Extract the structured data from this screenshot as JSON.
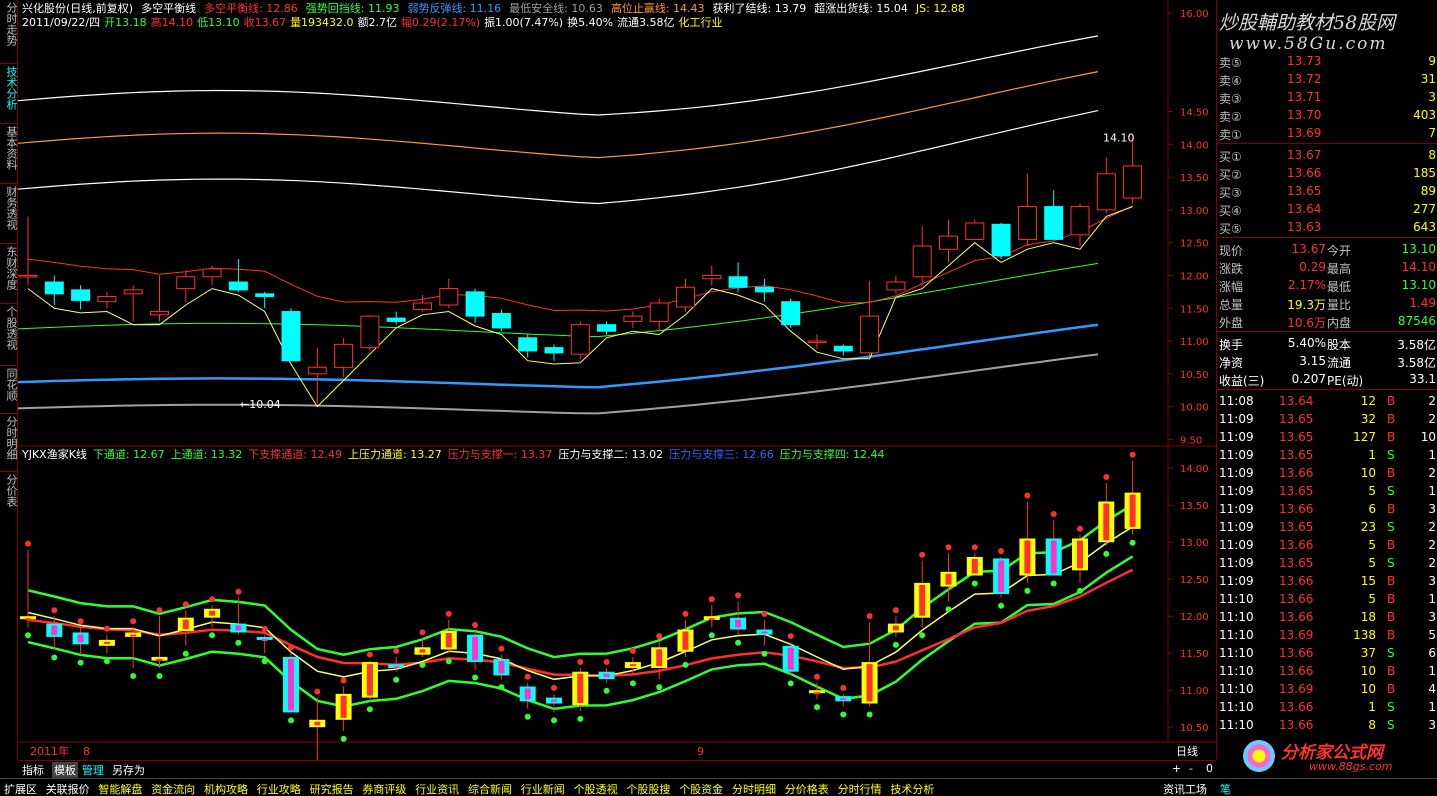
{
  "left_tabs": [
    {
      "label": "分时走势",
      "active": false
    },
    {
      "label": "技术分析",
      "active": true
    },
    {
      "label": "基本资料",
      "active": false
    },
    {
      "label": "财务透视",
      "active": false
    },
    {
      "label": "东财深度",
      "active": false
    },
    {
      "label": "个股透视",
      "active": false
    },
    {
      "label": "同花顺",
      "active": false
    },
    {
      "label": "分时明细",
      "active": false
    },
    {
      "label": "分价表",
      "active": false
    }
  ],
  "header1": [
    {
      "text": "兴化股份(日线,前复权)",
      "color": "#ffffff"
    },
    {
      "text": "多空平衡线",
      "color": "#ffffff"
    },
    {
      "text": "多空平衡线: 12.86",
      "color": "#ff3030"
    },
    {
      "text": "强势回挡线: 11.93",
      "color": "#30ff30"
    },
    {
      "text": "弱势反弹线: 11.16",
      "color": "#3399ff"
    },
    {
      "text": "最低安全线: 10.63",
      "color": "#a0a0a0"
    },
    {
      "text": "高位止赢线: 14.43",
      "color": "#ff9933"
    },
    {
      "text": "获利了结线: 13.79",
      "color": "#ffffff"
    },
    {
      "text": "超涨出货线: 15.04",
      "color": "#ffffff"
    },
    {
      "text": "JS: 12.88",
      "color": "#ffff00"
    }
  ],
  "header2": [
    {
      "text": "2011/09/22/四",
      "color": "#ffffff"
    },
    {
      "text": "开13.18",
      "color": "#30ff30"
    },
    {
      "text": "高14.10",
      "color": "#ff3030"
    },
    {
      "text": "低13.10",
      "color": "#30ff30"
    },
    {
      "text": "收13.67",
      "color": "#ff3030"
    },
    {
      "text": "量193432.0",
      "color": "#ffff00"
    },
    {
      "text": "额2.7亿",
      "color": "#ffffff"
    },
    {
      "text": "幅0.29(2.17%)",
      "color": "#ff3030"
    },
    {
      "text": "振1.00(7.47%)",
      "color": "#ffffff"
    },
    {
      "text": "换5.40%",
      "color": "#ffffff"
    },
    {
      "text": "流通3.58亿",
      "color": "#ffffff"
    },
    {
      "text": "化工行业",
      "color": "#ffff00"
    }
  ],
  "header3": [
    {
      "text": "YJKX渔家K线",
      "color": "#ffffff"
    },
    {
      "text": "下通道: 12.67",
      "color": "#30ff30"
    },
    {
      "text": "上通道: 13.32",
      "color": "#30ff30"
    },
    {
      "text": "下支撑通道: 12.49",
      "color": "#ff3030"
    },
    {
      "text": "上压力通道: 13.27",
      "color": "#ffff00"
    },
    {
      "text": "压力与支撑一: 13.37",
      "color": "#ff3030"
    },
    {
      "text": "压力与支撑二: 13.02",
      "color": "#ffffff"
    },
    {
      "text": "压力与支撑三: 12.66",
      "color": "#3366ff"
    },
    {
      "text": "压力与支撑四: 12.44",
      "color": "#30ff30"
    }
  ],
  "annotations": {
    "high": "14.10",
    "low": "←10.04"
  },
  "axis_top": [
    "16.00",
    "14.50",
    "14.00",
    "13.50",
    "13.00",
    "12.50",
    "12.00",
    "11.50",
    "11.00",
    "10.50",
    "10.00",
    "9.50"
  ],
  "axis_bottom": [
    "14.00",
    "13.50",
    "13.00",
    "12.50",
    "12.00",
    "11.50",
    "11.00",
    "10.50"
  ],
  "bottom_axis": {
    "year": "2011年",
    "m1": "8",
    "m2": "9"
  },
  "period": "日线",
  "zoom_controls": [
    "+",
    "-",
    "0"
  ],
  "watermark": {
    "line1": "炒股輔助教材58股网",
    "line2": "www.58Gu.com",
    "logo": "分析家公式网",
    "url": "www.88gs.com"
  },
  "orderbook": {
    "sell": [
      {
        "label": "卖⑤",
        "price": "13.73",
        "vol": "9"
      },
      {
        "label": "卖④",
        "price": "13.72",
        "vol": "31"
      },
      {
        "label": "卖③",
        "price": "13.71",
        "vol": "3"
      },
      {
        "label": "卖②",
        "price": "13.70",
        "vol": "403"
      },
      {
        "label": "卖①",
        "price": "13.69",
        "vol": "7"
      }
    ],
    "buy": [
      {
        "label": "买①",
        "price": "13.67",
        "vol": "8"
      },
      {
        "label": "买②",
        "price": "13.66",
        "vol": "185"
      },
      {
        "label": "买③",
        "price": "13.65",
        "vol": "89"
      },
      {
        "label": "买④",
        "price": "13.64",
        "vol": "277"
      },
      {
        "label": "买⑤",
        "price": "13.63",
        "vol": "643"
      }
    ]
  },
  "stats": [
    {
      "l1": "现价",
      "v1": "13.67",
      "c1": "#ff3030",
      "l2": "今开",
      "v2": "13.10",
      "c2": "#30ff30"
    },
    {
      "l1": "涨跌",
      "v1": "0.29",
      "c1": "#ff3030",
      "l2": "最高",
      "v2": "14.10",
      "c2": "#ff3030"
    },
    {
      "l1": "涨幅",
      "v1": "2.17%",
      "c1": "#ff3030",
      "l2": "最低",
      "v2": "13.10",
      "c2": "#30ff30"
    },
    {
      "l1": "总量",
      "v1": "19.3万",
      "c1": "#ffff00",
      "l2": "量比",
      "v2": "1.49",
      "c2": "#ff3030"
    },
    {
      "l1": "外盘",
      "v1": "10.6万",
      "c1": "#ff3030",
      "l2": "内盘",
      "v2": "87546",
      "c2": "#30ff30"
    }
  ],
  "fundamentals": [
    {
      "l1": "换手",
      "v1": "5.40%",
      "l2": "股本",
      "v2": "3.58亿"
    },
    {
      "l1": "净资",
      "v1": "3.15",
      "l2": "流通",
      "v2": "3.58亿"
    },
    {
      "l1": "收益(三)",
      "v1": "0.207",
      "l2": "PE(动)",
      "v2": "33.1"
    }
  ],
  "ticks": [
    {
      "t": "11:08",
      "p": "13.64",
      "v": "12",
      "bs": "B",
      "n": "2"
    },
    {
      "t": "11:09",
      "p": "13.65",
      "v": "32",
      "bs": "B",
      "n": "2"
    },
    {
      "t": "11:09",
      "p": "13.65",
      "v": "127",
      "bs": "B",
      "n": "10"
    },
    {
      "t": "11:09",
      "p": "13.65",
      "v": "1",
      "bs": "S",
      "n": "1"
    },
    {
      "t": "11:09",
      "p": "13.66",
      "v": "10",
      "bs": "B",
      "n": "2"
    },
    {
      "t": "11:09",
      "p": "13.65",
      "v": "5",
      "bs": "S",
      "n": "1"
    },
    {
      "t": "11:09",
      "p": "13.66",
      "v": "6",
      "bs": "B",
      "n": "3"
    },
    {
      "t": "11:09",
      "p": "13.65",
      "v": "23",
      "bs": "S",
      "n": "2"
    },
    {
      "t": "11:09",
      "p": "13.66",
      "v": "5",
      "bs": "B",
      "n": "2"
    },
    {
      "t": "11:09",
      "p": "13.65",
      "v": "5",
      "bs": "S",
      "n": "2"
    },
    {
      "t": "11:09",
      "p": "13.66",
      "v": "15",
      "bs": "B",
      "n": "3"
    },
    {
      "t": "11:10",
      "p": "13.66",
      "v": "5",
      "bs": "B",
      "n": "1"
    },
    {
      "t": "11:10",
      "p": "13.66",
      "v": "18",
      "bs": "B",
      "n": "3"
    },
    {
      "t": "11:10",
      "p": "13.69",
      "v": "138",
      "bs": "B",
      "n": "5"
    },
    {
      "t": "11:10",
      "p": "13.66",
      "v": "37",
      "bs": "S",
      "n": "6"
    },
    {
      "t": "11:10",
      "p": "13.66",
      "v": "10",
      "bs": "B",
      "n": "1"
    },
    {
      "t": "11:10",
      "p": "13.69",
      "v": "10",
      "bs": "B",
      "n": "4"
    },
    {
      "t": "11:10",
      "p": "13.66",
      "v": "1",
      "bs": "S",
      "n": "1"
    },
    {
      "t": "11:10",
      "p": "13.66",
      "v": "8",
      "bs": "S",
      "n": "3"
    }
  ],
  "bottom_tabs": [
    {
      "label": "指标",
      "active": false
    },
    {
      "label": "模板",
      "active": true
    },
    {
      "label": "管理",
      "active": false
    },
    {
      "label": "另存为",
      "active": false
    }
  ],
  "function_bar": [
    "扩展区",
    "关联报价",
    "智能解盘",
    "资金流向",
    "机构攻略",
    "行业攻略",
    "研究报告",
    "券商评级",
    "行业资讯",
    "综合新闻",
    "行业新闻",
    "个股透视",
    "个股股搜",
    "个股资金",
    "分时明细",
    "分价格表",
    "分时行情",
    "技术分析"
  ],
  "function_bar_right": [
    "资讯工场",
    "笔"
  ],
  "chart_data": {
    "type": "candlestick",
    "main_ylim": [
      9.4,
      16.2
    ],
    "sub_ylim": [
      10.3,
      14.3
    ],
    "candles": [
      [
        11.98,
        12.0,
        11.85,
        12.9
      ],
      [
        11.9,
        11.72,
        11.55,
        12.0
      ],
      [
        11.78,
        11.62,
        11.48,
        11.85
      ],
      [
        11.6,
        11.68,
        11.5,
        11.75
      ],
      [
        11.72,
        11.78,
        11.3,
        11.85
      ],
      [
        11.4,
        11.45,
        11.3,
        12.0
      ],
      [
        11.8,
        11.98,
        11.6,
        12.08
      ],
      [
        11.98,
        12.1,
        11.85,
        12.15
      ],
      [
        11.9,
        11.78,
        11.75,
        12.25
      ],
      [
        11.72,
        11.68,
        11.5,
        11.75
      ],
      [
        11.45,
        10.7,
        10.7,
        11.5
      ],
      [
        10.5,
        10.6,
        10.05,
        10.9
      ],
      [
        10.6,
        10.95,
        10.45,
        11.05
      ],
      [
        10.9,
        11.38,
        10.85,
        11.4
      ],
      [
        11.35,
        11.3,
        11.25,
        11.45
      ],
      [
        11.48,
        11.58,
        11.45,
        11.7
      ],
      [
        11.55,
        11.8,
        11.5,
        11.95
      ],
      [
        11.75,
        11.38,
        11.28,
        11.8
      ],
      [
        11.42,
        11.2,
        11.15,
        11.48
      ],
      [
        11.05,
        10.85,
        10.75,
        11.1
      ],
      [
        10.9,
        10.82,
        10.7,
        10.95
      ],
      [
        10.8,
        11.25,
        10.72,
        11.3
      ],
      [
        11.25,
        11.15,
        11.1,
        11.3
      ],
      [
        11.3,
        11.38,
        11.2,
        11.45
      ],
      [
        11.3,
        11.58,
        11.15,
        11.65
      ],
      [
        11.52,
        11.82,
        11.45,
        11.95
      ],
      [
        11.95,
        12.0,
        11.85,
        12.15
      ],
      [
        11.98,
        11.82,
        11.75,
        12.2
      ],
      [
        11.82,
        11.75,
        11.6,
        11.95
      ],
      [
        11.6,
        11.25,
        11.2,
        11.65
      ],
      [
        10.98,
        11.0,
        10.88,
        11.1
      ],
      [
        10.92,
        10.85,
        10.78,
        10.95
      ],
      [
        10.82,
        11.38,
        10.78,
        11.92
      ],
      [
        11.78,
        11.9,
        11.72,
        12.0
      ],
      [
        11.98,
        12.45,
        11.85,
        12.75
      ],
      [
        12.4,
        12.6,
        12.2,
        12.85
      ],
      [
        12.55,
        12.8,
        12.55,
        12.85
      ],
      [
        12.78,
        12.3,
        12.25,
        12.8
      ],
      [
        12.55,
        13.05,
        12.45,
        13.55
      ],
      [
        13.05,
        12.55,
        12.55,
        13.3
      ],
      [
        12.62,
        13.05,
        12.45,
        13.1
      ],
      [
        13.0,
        13.55,
        12.95,
        13.8
      ],
      [
        13.18,
        13.67,
        13.1,
        14.1
      ]
    ]
  }
}
